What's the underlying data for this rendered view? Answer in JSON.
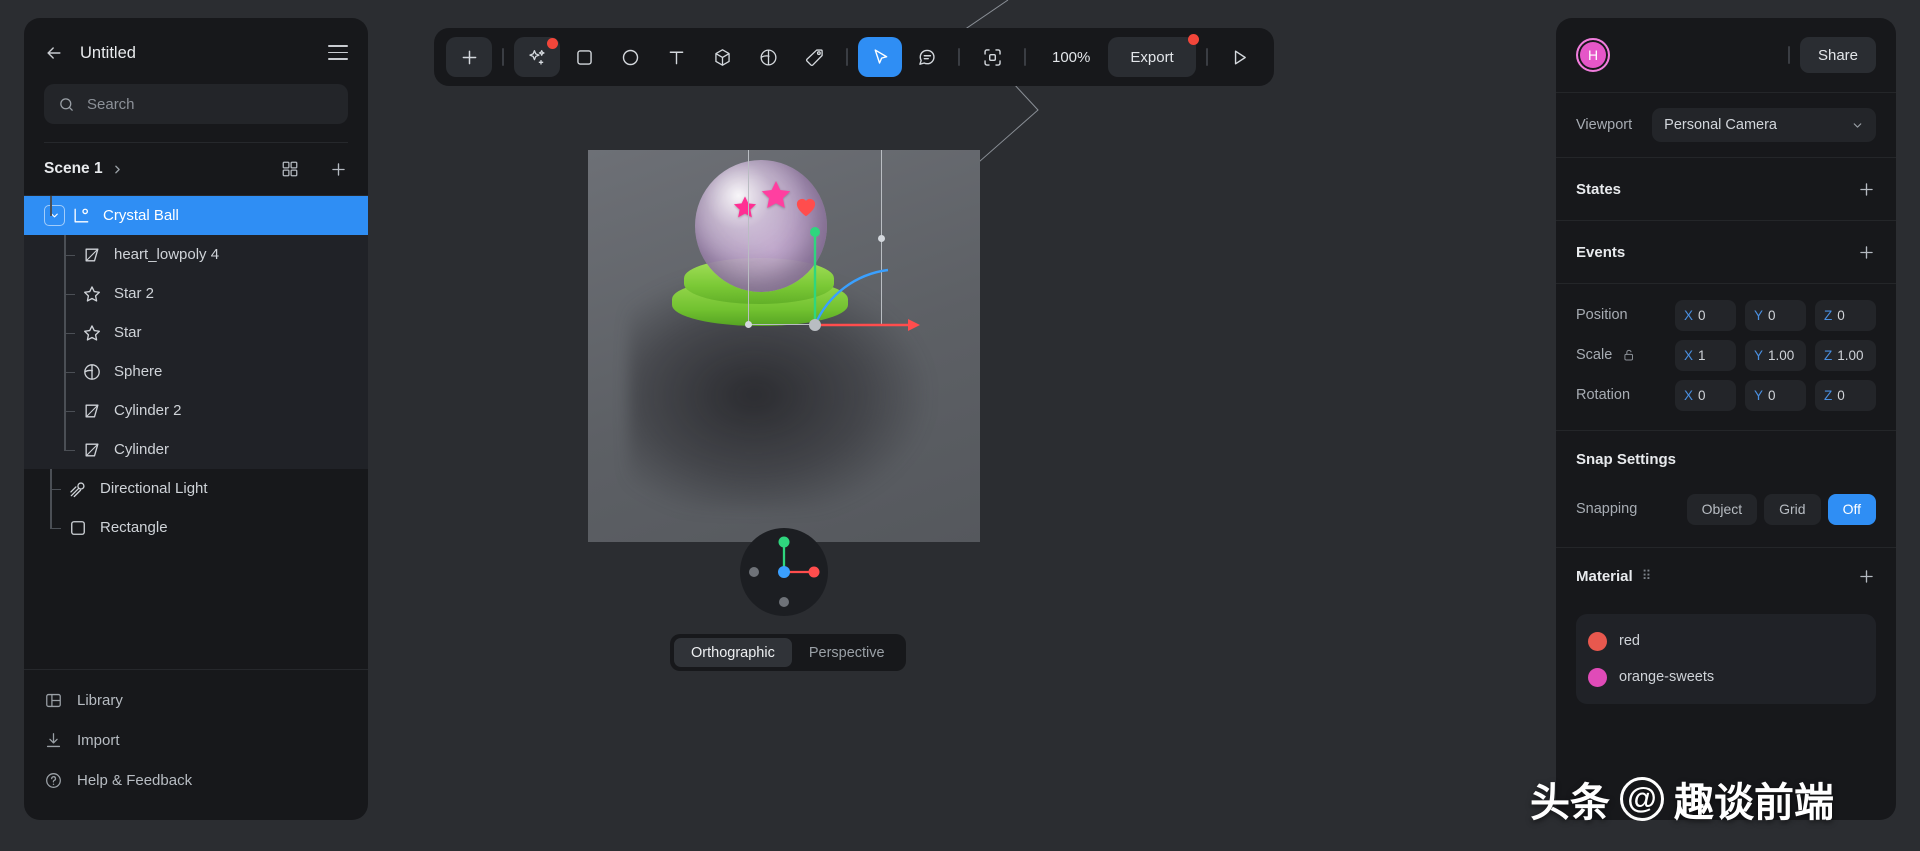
{
  "sidebar": {
    "back_icon": "back-arrow-icon",
    "title": "Untitled",
    "menu_icon": "hamburger-menu-icon",
    "search": {
      "placeholder": "Search",
      "icon": "search-icon"
    },
    "scene": {
      "name": "Scene 1",
      "chevron": "chevron-right-icon",
      "grid_icon": "grid-view-icon",
      "add_icon": "add-layer-icon"
    },
    "tree": [
      {
        "label": "Crystal Ball",
        "icon": "group-icon",
        "depth": 0,
        "selected": true,
        "expanded": true
      },
      {
        "label": "heart_lowpoly 4",
        "icon": "mesh-icon",
        "depth": 1,
        "selected": false
      },
      {
        "label": "Star 2",
        "icon": "star-icon",
        "depth": 1,
        "selected": false
      },
      {
        "label": "Star",
        "icon": "star-icon",
        "depth": 1,
        "selected": false
      },
      {
        "label": "Sphere",
        "icon": "sphere-icon",
        "depth": 1,
        "selected": false
      },
      {
        "label": "Cylinder 2",
        "icon": "mesh-icon",
        "depth": 1,
        "selected": false
      },
      {
        "label": "Cylinder",
        "icon": "mesh-icon",
        "depth": 1,
        "selected": false
      },
      {
        "label": "Directional Light",
        "icon": "directional-light-icon",
        "depth": 0,
        "selected": false
      },
      {
        "label": "Rectangle",
        "icon": "rectangle-icon",
        "depth": 0,
        "selected": false
      }
    ],
    "footer": [
      {
        "label": "Library",
        "icon": "library-icon"
      },
      {
        "label": "Import",
        "icon": "import-icon"
      },
      {
        "label": "Help & Feedback",
        "icon": "help-circle-icon"
      }
    ]
  },
  "toolbar": {
    "add_label": "add-icon",
    "tools": [
      {
        "name": "ai-generate-icon",
        "badge": true,
        "active": false,
        "boxed": true
      },
      {
        "name": "square-tool-icon",
        "badge": false,
        "active": false
      },
      {
        "name": "circle-tool-icon",
        "badge": false,
        "active": false
      },
      {
        "name": "text-tool-icon",
        "badge": false,
        "active": false
      },
      {
        "name": "cube-tool-icon",
        "badge": false,
        "active": false
      },
      {
        "name": "sphere-tool-icon",
        "badge": false,
        "active": false
      },
      {
        "name": "pen-tool-icon",
        "badge": false,
        "active": false
      }
    ],
    "cursor_icon": "cursor-select-icon",
    "comment_icon": "comment-icon",
    "frame_icon": "frame-select-icon",
    "zoom_level": "100%",
    "export_label": "Export",
    "play_icon": "play-preview-icon"
  },
  "viewport": {
    "projection": {
      "options": [
        "Orthographic",
        "Perspective"
      ],
      "selected": "Orthographic"
    },
    "orientation_widget": "axis-orientation-gizmo"
  },
  "right": {
    "avatar_initial": "H",
    "share_label": "Share",
    "viewport_label": "Viewport",
    "viewport_value": "Personal Camera",
    "states_label": "States",
    "events_label": "Events",
    "transform": {
      "position": {
        "label": "Position",
        "x": "0",
        "y": "0",
        "z": "0"
      },
      "scale": {
        "label": "Scale",
        "x": "1",
        "y": "1.00",
        "z": "1.00",
        "lock_icon": "unlock-icon"
      },
      "rotation": {
        "label": "Rotation",
        "x": "0",
        "y": "0",
        "z": "0"
      },
      "axes": {
        "x": "X",
        "y": "Y",
        "z": "Z"
      }
    },
    "snap": {
      "title": "Snap Settings",
      "label": "Snapping",
      "options": [
        "Object",
        "Grid",
        "Off"
      ],
      "selected": "Off"
    },
    "material": {
      "title": "Material",
      "items": [
        {
          "name": "red",
          "color": "#e8584e"
        },
        {
          "name": "orange-sweets",
          "color": "#e04bb8"
        }
      ]
    }
  },
  "colors": {
    "accent": "#2f8ef4",
    "badge": "#f2463a",
    "avatar": "#e556c8"
  },
  "watermark": {
    "prefix": "头条",
    "at": "@",
    "handle": "趣谈前端"
  }
}
